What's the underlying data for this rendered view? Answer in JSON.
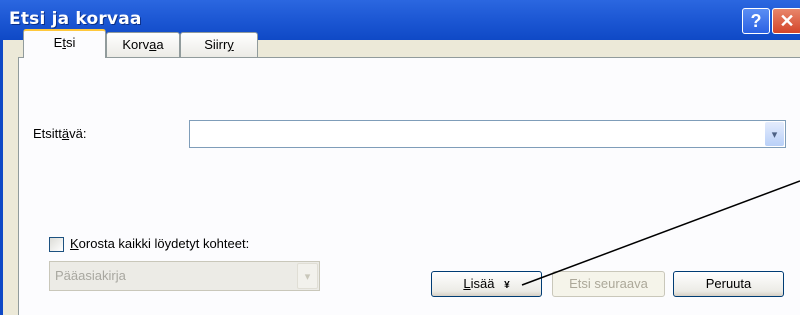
{
  "window": {
    "title": "Etsi ja korvaa"
  },
  "titlebar": {
    "help_glyph": "?",
    "close_glyph": "✕"
  },
  "tabs": [
    {
      "label_pre": "E",
      "label_ul": "t",
      "label_post": "si"
    },
    {
      "label_pre": "Korv",
      "label_ul": "a",
      "label_post": "a"
    },
    {
      "label_pre": "Siirr",
      "label_ul": "y",
      "label_post": ""
    }
  ],
  "find": {
    "label_pre": "Etsitt",
    "label_ul": "ä",
    "label_post": "vä:",
    "value": "",
    "arrow_glyph": "▾"
  },
  "highlight": {
    "label_pre": "",
    "label_ul": "K",
    "label_post": "orosta kaikki löydetyt kohteet:",
    "checked": false
  },
  "scope": {
    "value": "Pääasiakirja",
    "arrow_glyph": "▾"
  },
  "buttons": {
    "more_pre": "",
    "more_ul": "L",
    "more_post": "isää",
    "more_glyph": "¥",
    "find_next": "Etsi seuraava",
    "cancel": "Peruuta"
  }
}
